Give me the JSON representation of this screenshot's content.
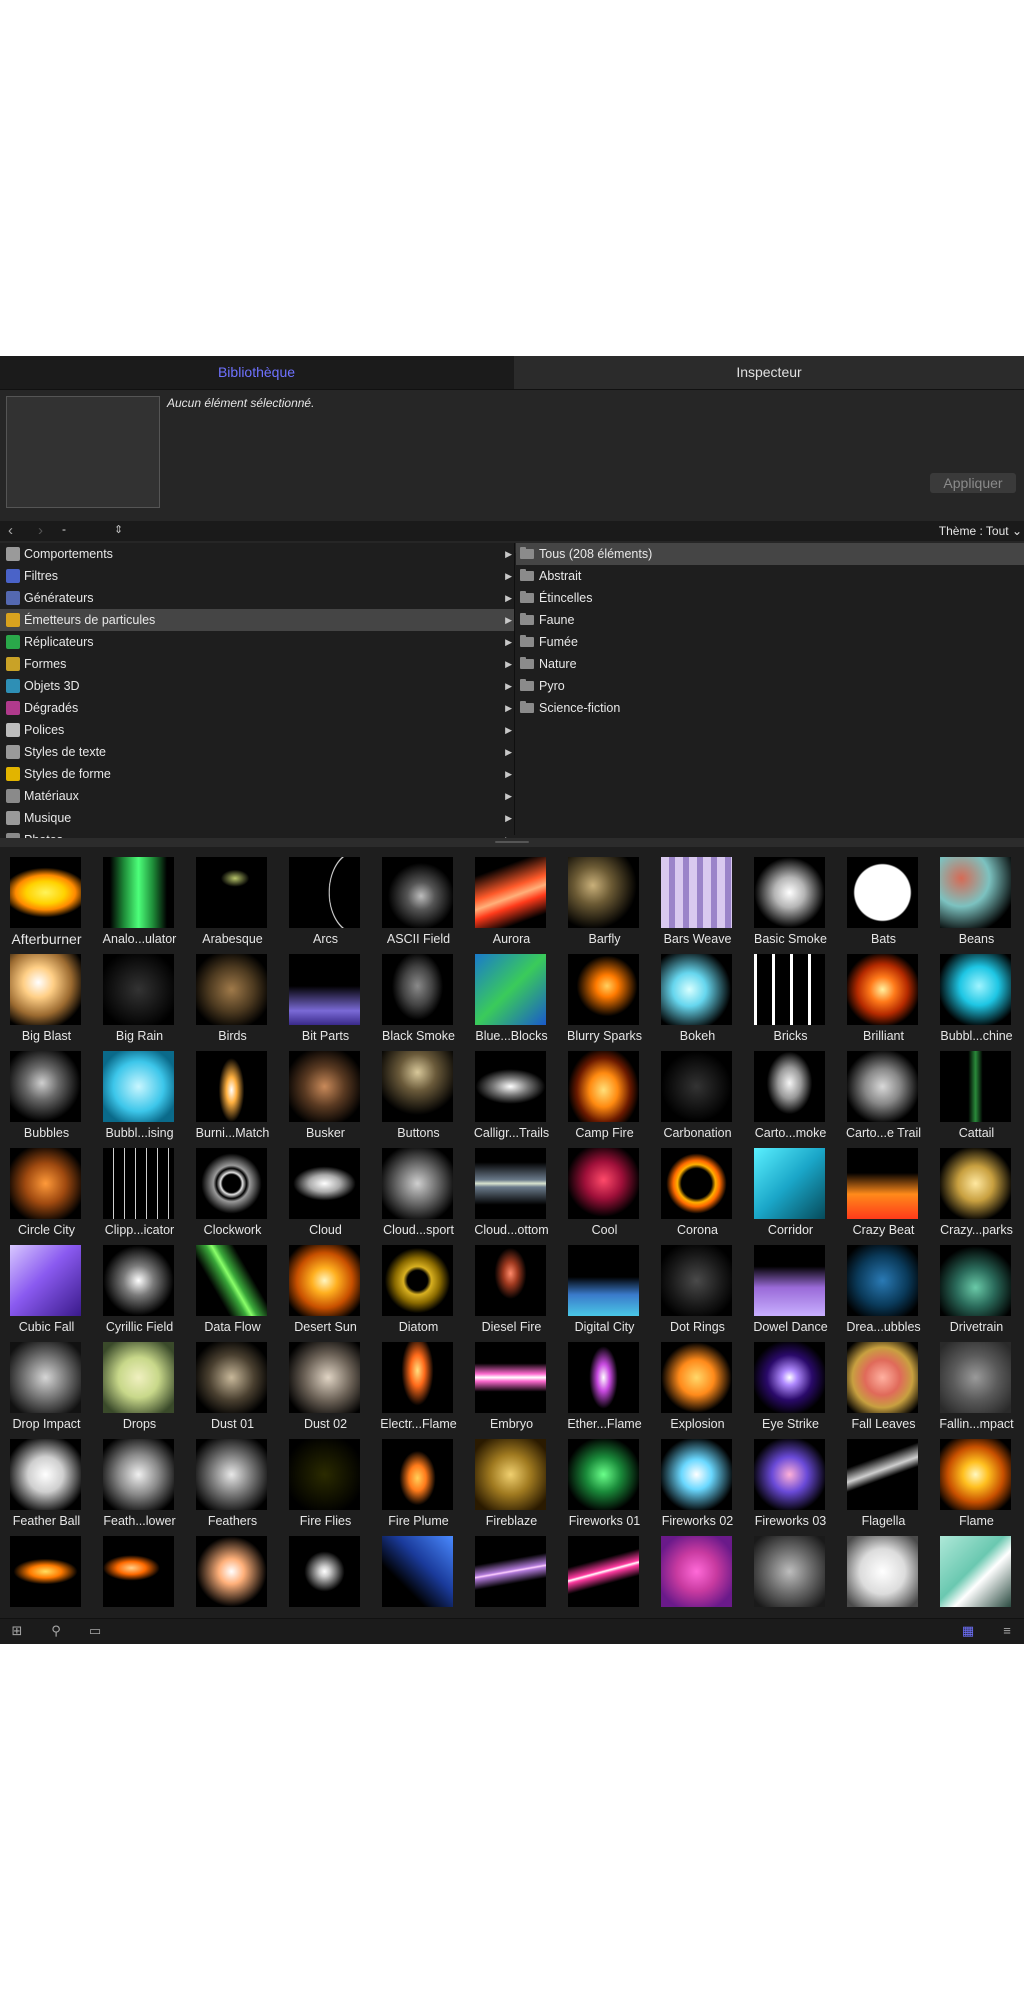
{
  "tabs": {
    "library": "Bibliothèque",
    "inspector": "Inspecteur"
  },
  "preview": {
    "no_selection": "Aucun élément sélectionné.",
    "apply": "Appliquer"
  },
  "nav": {
    "back": "‹",
    "forward": "›",
    "path": "-",
    "stepper": "⇕",
    "theme": "Thème : Tout ⌄"
  },
  "categories": [
    {
      "label": "Comportements",
      "icon": "gear-icon",
      "color": "#9a9a9a"
    },
    {
      "label": "Filtres",
      "icon": "filter-icon",
      "color": "#4a63c8"
    },
    {
      "label": "Générateurs",
      "icon": "generator-icon",
      "color": "#5468b0"
    },
    {
      "label": "Émetteurs de particules",
      "icon": "particle-emitter-icon",
      "color": "#d8a21e"
    },
    {
      "label": "Réplicateurs",
      "icon": "replicator-icon",
      "color": "#2aa84a"
    },
    {
      "label": "Formes",
      "icon": "shape-icon",
      "color": "#c9a227"
    },
    {
      "label": "Objets 3D",
      "icon": "cube-3d-icon",
      "color": "#2e8fb5"
    },
    {
      "label": "Dégradés",
      "icon": "gradient-icon",
      "color": "#b03a8c"
    },
    {
      "label": "Polices",
      "icon": "font-icon",
      "color": "#bdbdbd"
    },
    {
      "label": "Styles de texte",
      "icon": "text-style-icon",
      "color": "#9a9a9a"
    },
    {
      "label": "Styles de forme",
      "icon": "shape-style-icon",
      "color": "#e2b400"
    },
    {
      "label": "Matériaux",
      "icon": "material-icon",
      "color": "#8a8a8a"
    },
    {
      "label": "Musique",
      "icon": "music-icon",
      "color": "#9a9a9a"
    },
    {
      "label": "Photos",
      "icon": "photo-icon",
      "color": "#8a8a8a"
    }
  ],
  "subcategories": [
    "Tous (208 éléments)",
    "Abstrait",
    "Étincelles",
    "Faune",
    "Fumée",
    "Nature",
    "Pyro",
    "Science-fiction"
  ],
  "items": [
    "Afterburner",
    "Analo...ulator",
    "Arabesque",
    "Arcs",
    "ASCII Field",
    "Aurora",
    "Barfly",
    "Bars Weave",
    "Basic Smoke",
    "Bats",
    "Beans",
    "Big Blast",
    "Big Rain",
    "Birds",
    "Bit Parts",
    "Black Smoke",
    "Blue...Blocks",
    "Blurry Sparks",
    "Bokeh",
    "Bricks",
    "Brilliant",
    "Bubbl...chine",
    "Bubbles",
    "Bubbl...ising",
    "Burni...Match",
    "Busker",
    "Buttons",
    "Calligr...Trails",
    "Camp Fire",
    "Carbonation",
    "Carto...moke",
    "Carto...e Trail",
    "Cattail",
    "Circle City",
    "Clipp...icator",
    "Clockwork",
    "Cloud",
    "Cloud...sport",
    "Cloud...ottom",
    "Cool",
    "Corona",
    "Corridor",
    "Crazy Beat",
    "Crazy...parks",
    "Cubic Fall",
    "Cyrillic Field",
    "Data Flow",
    "Desert Sun",
    "Diatom",
    "Diesel Fire",
    "Digital City",
    "Dot Rings",
    "Dowel Dance",
    "Drea...ubbles",
    "Drivetrain",
    "Drop Impact",
    "Drops",
    "Dust 01",
    "Dust 02",
    "Electr...Flame",
    "Embryo",
    "Ether...Flame",
    "Explosion",
    "Eye Strike",
    "Fall Leaves",
    "Fallin...mpact",
    "Feather Ball",
    "Feath...lower",
    "Feathers",
    "Fire Flies",
    "Fire Plume",
    "Fireblaze",
    "Fireworks 01",
    "Fireworks 02",
    "Fireworks 03",
    "Flagella",
    "Flame",
    "",
    "",
    "",
    "",
    "",
    "",
    "",
    "",
    "",
    "",
    ""
  ],
  "thumbs": [
    "radial-gradient(ellipse 60% 35% at 50% 50%, #fff45a 0%, #ffd200 45%, #ff8a00 70%, #000 100%)",
    "linear-gradient(90deg,#000 10%,#1f8f3a 30%,#4dff7a 50%,#1f8f3a 70%,#000 90%)",
    "radial-gradient(ellipse 20% 12% at 55% 30%, #b7c46a 0%, #000 100%)",
    "radial-gradient(ellipse 60% 90% at 95% 50%, #000 62%, #fff 64%, #000 66%)",
    "radial-gradient(circle at 55% 55%, #bdbdbd 0%, #555 25%, #000 60%)",
    "linear-gradient(160deg,#000 20%,#ff5a2a 45%,#ffb07a 55%,#ff3a1a 65%,#000 85%)",
    "radial-gradient(circle at 35% 40%, #c9b07a 0%, #6b5a34 30%, #000 70%)",
    "repeating-linear-gradient(90deg,#d9c9ef 0 8px,#9b84c9 8px 14px)",
    "radial-gradient(circle at 50% 50%, #ffffff 0%, #b5b5b5 30%, #000 70%)",
    "radial-gradient(circle at 50% 50%, #fff 55%, #000 58%)",
    "radial-gradient(circle at 30% 30%, #d66a55 0%, #7cc2c0 40%, #000 80%)",
    "radial-gradient(circle at 40% 40%, #ffffff 0%, #ffcf86 25%, #9b6a30 55%, #000 80%)",
    "radial-gradient(circle at 50% 50%, #333 0%, #000 80%)",
    "radial-gradient(circle at 50% 50%, #a07a4a 0%, #4d3a20 45%, #000 80%)",
    "linear-gradient(0deg,#3a2a8a 0%,#7a6ad6 20%,#000 55%)",
    "radial-gradient(ellipse 45% 60% at 50% 45%, #8a8a8a 0%, #444 45%, #000 80%)",
    "linear-gradient(135deg,#1a7acb 0%,#3acb5a 50%,#1a5acb 100%)",
    "radial-gradient(circle at 55% 45%, #ffd060 0%, #ff7a00 20%, #000 55%)",
    "radial-gradient(circle at 40% 50%, #d8ffff 0%, #66d6ee 30%, #000 75%)",
    "repeating-linear-gradient(90deg,#fff 0 3px,#000 3px 18px)",
    "radial-gradient(circle at 50% 50%, #fff2a0 0%, #ff7a1a 25%, #b52a00 50%, #000 75%)",
    "radial-gradient(circle at 55% 45%, #9ff4ff 0%, #1ec6e4 35%, #000 75%)",
    "radial-gradient(circle at 45% 45%, #cfcfcf 0%, #6a6a6a 30%, #000 70%)",
    "radial-gradient(circle at 50% 50%, #c8f6ff 0%, #3cc6ea 50%, #0a6a8a 80%)",
    "radial-gradient(ellipse 18% 45% at 50% 55%, #fff 0%, #ffb040 40%, #000 100%)",
    "radial-gradient(circle at 50% 50%, #c98a5a 0%, #5a3a22 40%, #000 80%)",
    "radial-gradient(circle at 50% 30%, #d8c89a 0%, #6a5a3a 30%, #000 70%)",
    "radial-gradient(ellipse 70% 35% at 50% 50%, #ffffff 0%, #777 35%, #000 70%)",
    "radial-gradient(ellipse 50% 60% at 50% 55%, #ffe07a 0%, #ff8a10 40%, #6a1a00 75%, #000 100%)",
    "radial-gradient(circle at 50% 50%, #333 0%, #000 70%)",
    "radial-gradient(ellipse 40% 55% at 50% 45%, #f5f5f5 0%, #9a9a9a 40%, #000 80%)",
    "radial-gradient(circle at 50% 50%, #d9d9d9 0%, #888 35%, #000 75%)",
    "linear-gradient(90deg,#000 40%,#2a8a3a 50%,#000 60%)",
    "radial-gradient(circle at 50% 50%, #ff9a3a 0%, #a04a10 40%, #000 80%)",
    "repeating-linear-gradient(90deg,#000 0 10px,#cfcfcf 10px 11px)",
    "radial-gradient(circle at 50% 50%, #000 18%, #e6e6e6 22%, #000 30%, #9a9a9a 36%, #000 60%)",
    "radial-gradient(ellipse 55% 30% at 50% 50%, #ffffff 0%, #aaa 40%, #000 80%)",
    "radial-gradient(circle at 50% 50%, #cfcfcf 0%, #6a6a6a 40%, #000 80%)",
    "linear-gradient(180deg,#000 20%,#6a7a8a 45%,#d9e4cf 50%,#6a7a8a 55%,#000 80%)",
    "radial-gradient(circle at 50% 45%, #ff4a6a 0%, #a0103a 35%, #000 70%)",
    "radial-gradient(circle at 50% 50%, #000 30%, #ffb000 38%, #ff6a00 46%, #000 60%)",
    "linear-gradient(135deg,#5af0ff 0%,#1aa6c8 50%,#064a5a 100%)",
    "linear-gradient(0deg,#ff3a1a 0%,#ff8a1a 35%,#000 65%)",
    "radial-gradient(circle at 50% 50%, #ffe8a0 0%, #c8a040 35%, #000 75%)",
    "linear-gradient(135deg,#d8c8ff 0%,#8a5af0 45%,#3a1a8a 100%)",
    "radial-gradient(circle at 50% 50%, #fff 0%, #7a7a7a 30%, #000 70%)",
    "linear-gradient(60deg,#000 30%,#3aa83a 45%,#8aff6a 50%,#3aa83a 55%,#000 70%)",
    "radial-gradient(circle at 50% 50%, #fff6c0 0%, #ffb020 25%, #c85000 55%, #000 85%)",
    "radial-gradient(circle at 50% 50%, #000 20%, #d8b020 28%, #8a6a00 45%, #000 65%)",
    "radial-gradient(ellipse 25% 40% at 50% 40%, #ff8a6a 0%, #a03a20 40%, #000 90%)",
    "linear-gradient(0deg,#4ac8e6 0%,#3a7acb 30%,#000 55%)",
    "radial-gradient(circle at 50% 50%, #4a4a4a 0%, #1a1a1a 50%, #000 80%)",
    "linear-gradient(0deg,#c8b0ff 0%,#9a6ad8 40%,#000 70%)",
    "radial-gradient(circle at 50% 50%, #2a7ab5 0%, #0a3a5a 50%, #000 85%)",
    "radial-gradient(circle at 50% 60%, #6acaa8 0%, #2a6a5a 35%, #000 75%)",
    "radial-gradient(circle at 50% 50%, #d6d6d6 0%, #7a7a7a 40%, #111 85%)",
    "radial-gradient(circle at 50% 50%, #f0f0c0 0%, #c8d88a 40%, #3a4a2a 85%)",
    "radial-gradient(circle at 50% 50%, #c8b89a 0%, #4a4030 45%, #000 80%)",
    "radial-gradient(circle at 55% 50%, #e0d4c4 0%, #6a6055 45%, #000 85%)",
    "radial-gradient(ellipse 25% 55% at 50% 40%, #ffe080 0%, #ff6a1a 40%, #000 90%)",
    "linear-gradient(180deg,#000 30%,#ff6ad0 45%,#ffffff 50%,#ff6ad0 55%,#000 70%)",
    "radial-gradient(ellipse 25% 55% at 50% 50%, #ffffff 0%, #c84ae0 35%, #000 80%)",
    "radial-gradient(circle at 50% 50%, #ffd86a 0%, #ff8a1a 35%, #000 70%)",
    "radial-gradient(circle at 50% 50%, #ffffff 0%, #b08aff 15%, #2a0a6a 45%, #000 75%)",
    "radial-gradient(circle at 50% 50%, #ffb0a0 0%, #e06a5a 35%, #c8a040 60%, #000 90%)",
    "radial-gradient(circle at 50% 50%, #9a9a9a 0%, #5a5a5a 45%, #2a2a2a 90%)",
    "radial-gradient(circle at 50% 50%, #ffffff 0%, #cfcfcf 35%, #000 80%)",
    "radial-gradient(circle at 50% 50%, #f0f0f0 0%, #8a8a8a 40%, #000 85%)",
    "radial-gradient(circle at 50% 50%, #e8e8e8 0%, #7a7a7a 40%, #000 85%)",
    "radial-gradient(circle at 50% 50%, #2a2a00 0%, #000 80%)",
    "radial-gradient(ellipse 30% 45% at 50% 55%, #ffd05a 0%, #ff7a1a 40%, #000 85%)",
    "radial-gradient(circle at 50% 50%, #f0d070 0%, #a07a20 40%, #2a1a00 85%)",
    "radial-gradient(circle at 50% 50%, #6aff8a 0%, #1a8a3a 35%, #000 75%)",
    "radial-gradient(circle at 50% 50%, #ffffff 0%, #6ad8ff 30%, #000 75%)",
    "radial-gradient(circle at 50% 50%, #ffb0d8 0%, #6a4ad8 35%, #000 75%)",
    "linear-gradient(160deg,#000 30%,#cfcfcf 45%,#000 55%)",
    "radial-gradient(circle at 50% 50%, #fff8c0 0%, #ffc020 25%, #c85000 55%, #000 85%)",
    "radial-gradient(ellipse 45% 18% at 50% 50%, #ffe060 0%, #ff7a00 50%, #000 100%)",
    "radial-gradient(ellipse 40% 18% at 40% 45%, #ffd08a 0%, #ff6a00 50%, #000 100%)",
    "radial-gradient(circle at 50% 50%, #ffffff 0%, #ffb07a 25%, #000 70%)",
    "radial-gradient(circle at 50% 50%, #ffffff 0%, #cfcfcf 10%, #000 40%)",
    "linear-gradient(225deg,#4a8aff 0%,#1a3a9a 40%,#000 70%)",
    "linear-gradient(170deg,#000 35%,#b07ad8 48%,#ffd0ff 50%,#b07ad8 52%,#000 65%)",
    "linear-gradient(165deg,#000 35%,#ff3aa0 48%,#ffffff 50%,#ff3aa0 53%,#000 65%)",
    "radial-gradient(circle at 50% 50%, #ff6ad8 0%, #c83aa0 40%, #6a1a8a 80%)",
    "radial-gradient(circle at 50% 50%, #bdbdbd 0%, #6a6a6a 45%, #1a1a1a 90%)",
    "radial-gradient(circle at 50% 50%, #ffffff 0%, #dcdcdc 45%, #4a4a4a 90%)",
    "linear-gradient(135deg,#aee8d8 0%,#6ac8b0 45%,#fff 60%,#2a4a40 100%)"
  ],
  "bottom": {
    "new_folder": "⊞",
    "search": "⚲",
    "preview_toggle": "▭",
    "grid_view": "▦",
    "list_view": "≡"
  }
}
